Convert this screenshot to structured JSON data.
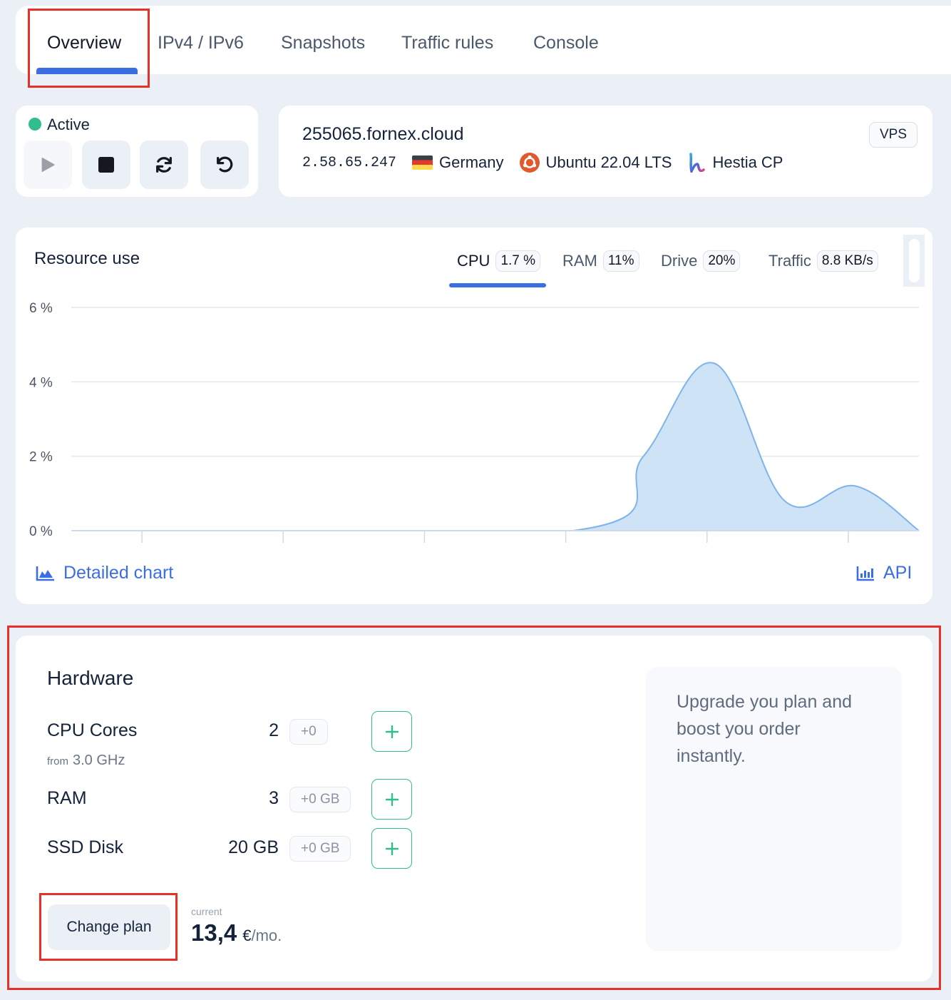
{
  "tabs": {
    "items": [
      {
        "label": "Overview",
        "active": true
      },
      {
        "label": "IPv4 / IPv6",
        "active": false
      },
      {
        "label": "Snapshots",
        "active": false
      },
      {
        "label": "Traffic rules",
        "active": false
      },
      {
        "label": "Console",
        "active": false
      }
    ]
  },
  "status": {
    "label": "Active",
    "color": "#33bd8c",
    "controls": [
      {
        "name": "start",
        "icon": "play-icon",
        "disabled": true
      },
      {
        "name": "stop",
        "icon": "stop-icon",
        "disabled": false
      },
      {
        "name": "restart",
        "icon": "refresh-icon",
        "disabled": false
      },
      {
        "name": "reinstall",
        "icon": "undo-icon",
        "disabled": false
      }
    ]
  },
  "server": {
    "hostname": "255065.fornex.cloud",
    "type_badge": "VPS",
    "ip": "2.58.65.247",
    "location": {
      "label": "Germany",
      "icon": "germany-flag-icon"
    },
    "os": {
      "label": "Ubuntu 22.04 LTS",
      "icon": "ubuntu-icon"
    },
    "panel": {
      "label": "Hestia CP",
      "icon": "hestia-icon"
    }
  },
  "resources": {
    "title": "Resource use",
    "metrics": [
      {
        "label": "CPU",
        "value": "1.7 %",
        "active": true
      },
      {
        "label": "RAM",
        "value": "11%",
        "active": false
      },
      {
        "label": "Drive",
        "value": "20%",
        "active": false
      },
      {
        "label": "Traffic",
        "value": "8.8 KB/s",
        "active": false
      }
    ],
    "detailed_chart_label": "Detailed chart",
    "api_label": "API",
    "accent": "#3b6ee3"
  },
  "chart_data": {
    "type": "area",
    "title": "",
    "xlabel": "",
    "ylabel": "",
    "ylim": [
      0,
      6
    ],
    "xlim": [
      0,
      12
    ],
    "yticks": [
      0,
      2,
      4,
      6
    ],
    "ytick_labels": [
      "0 %",
      "2 %",
      "4 %",
      "6 %"
    ],
    "xticks": [
      1,
      3,
      5,
      7,
      9,
      11
    ],
    "xtick_labels": [
      "",
      "",
      "",
      "",
      "",
      ""
    ],
    "grid": true,
    "series": [
      {
        "name": "CPU",
        "color": "#7eb4e8",
        "fill": "#cbe1f6",
        "x": [
          0,
          7.1,
          8.1,
          9.1,
          10.1,
          11.1,
          12.0
        ],
        "y": [
          0,
          0,
          2.0,
          4.5,
          0.8,
          1.2,
          0
        ]
      }
    ]
  },
  "hardware": {
    "title": "Hardware",
    "rows": [
      {
        "label": "CPU Cores",
        "value": "2",
        "delta": "+0",
        "sub_prefix": "from",
        "sub_value": "3.0 GHz"
      },
      {
        "label": "RAM",
        "value": "3",
        "delta": "+0 GB"
      },
      {
        "label": "SSD Disk",
        "value": "20 GB",
        "delta": "+0 GB"
      }
    ],
    "change_plan_label": "Change plan",
    "price_caption": "current",
    "price_value": "13,4",
    "price_currency": "€",
    "price_period": "/mo.",
    "upgrade_text": "Upgrade you plan and boost you order instantly."
  }
}
